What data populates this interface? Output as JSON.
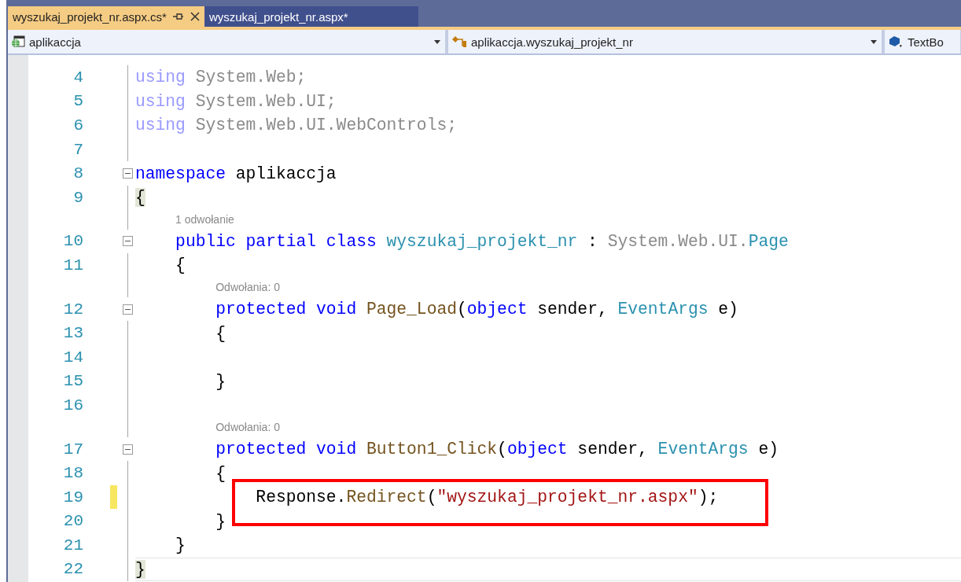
{
  "tabs": [
    {
      "label": "wyszukaj_projekt_nr.aspx.cs*",
      "selected": true
    },
    {
      "label": "wyszukaj_projekt_nr.aspx*",
      "selected": false
    }
  ],
  "nav_bar": [
    {
      "kind": "project",
      "label": "aplikaccja"
    },
    {
      "kind": "class",
      "label": "aplikaccja.wyszukaj_projekt_nr"
    },
    {
      "kind": "member",
      "label": "TextBo"
    }
  ],
  "lines": [
    {
      "kind": "code",
      "number": "4",
      "fold": false,
      "modified": false,
      "boxed": false,
      "current": false,
      "tokens": [
        {
          "text": "using",
          "kind": "faded-keyword"
        },
        {
          "text": " System.Web;",
          "kind": "faded"
        }
      ]
    },
    {
      "kind": "code",
      "number": "5",
      "fold": false,
      "modified": false,
      "boxed": false,
      "current": false,
      "tokens": [
        {
          "text": "using",
          "kind": "faded-keyword"
        },
        {
          "text": " System.Web.UI;",
          "kind": "faded"
        }
      ]
    },
    {
      "kind": "code",
      "number": "6",
      "fold": false,
      "modified": false,
      "boxed": false,
      "current": false,
      "tokens": [
        {
          "text": "using",
          "kind": "faded-keyword"
        },
        {
          "text": " System.Web.UI.WebControls;",
          "kind": "faded"
        }
      ]
    },
    {
      "kind": "code",
      "number": "7",
      "fold": false,
      "modified": false,
      "boxed": false,
      "current": false
    },
    {
      "kind": "code",
      "number": "8",
      "fold": true,
      "modified": false,
      "boxed": false,
      "current": false,
      "tokens": [
        {
          "text": "namespace",
          "kind": "keyword"
        },
        {
          "text": " aplikaccja",
          "kind": "plain"
        }
      ]
    },
    {
      "kind": "code",
      "number": "9",
      "fold": false,
      "modified": false,
      "boxed": false,
      "current": false,
      "tokens": [
        {
          "text": "{",
          "kind": "brace-match"
        }
      ]
    },
    {
      "kind": "codelens",
      "text": "1 odwołanie"
    },
    {
      "kind": "code",
      "number": "10",
      "fold": true,
      "modified": false,
      "boxed": false,
      "current": false,
      "tokens": [
        {
          "text": "    public partial class ",
          "kind": "keyword"
        },
        {
          "text": "wyszukaj_projekt_nr",
          "kind": "type"
        },
        {
          "text": " : ",
          "kind": "plain"
        },
        {
          "text": "System.Web.UI.",
          "kind": "faded"
        },
        {
          "text": "Page",
          "kind": "type"
        }
      ]
    },
    {
      "kind": "code",
      "number": "11",
      "fold": false,
      "modified": false,
      "boxed": false,
      "current": false,
      "tokens": [
        {
          "text": "    {",
          "kind": "plain"
        }
      ]
    },
    {
      "kind": "codelens",
      "text": "Odwołania: 0"
    },
    {
      "kind": "code",
      "number": "12",
      "fold": true,
      "modified": false,
      "boxed": false,
      "current": false,
      "tokens": [
        {
          "text": "        protected void ",
          "kind": "keyword"
        },
        {
          "text": "Page_Load",
          "kind": "method"
        },
        {
          "text": "(",
          "kind": "plain"
        },
        {
          "text": "object",
          "kind": "keyword"
        },
        {
          "text": " sender, ",
          "kind": "plain"
        },
        {
          "text": "EventArgs",
          "kind": "type"
        },
        {
          "text": " e)",
          "kind": "plain"
        }
      ]
    },
    {
      "kind": "code",
      "number": "13",
      "fold": false,
      "modified": false,
      "boxed": false,
      "current": false,
      "tokens": [
        {
          "text": "        {",
          "kind": "plain"
        }
      ]
    },
    {
      "kind": "code",
      "number": "14",
      "fold": false,
      "modified": false,
      "boxed": false,
      "current": false
    },
    {
      "kind": "code",
      "number": "15",
      "fold": false,
      "modified": false,
      "boxed": false,
      "current": false,
      "tokens": [
        {
          "text": "        }",
          "kind": "plain"
        }
      ]
    },
    {
      "kind": "code",
      "number": "16",
      "fold": false,
      "modified": false,
      "boxed": false,
      "current": false
    },
    {
      "kind": "codelens",
      "text": "Odwołania: 0"
    },
    {
      "kind": "code",
      "number": "17",
      "fold": true,
      "modified": false,
      "boxed": false,
      "current": false,
      "tokens": [
        {
          "text": "        protected void ",
          "kind": "keyword"
        },
        {
          "text": "Button1_Click",
          "kind": "method"
        },
        {
          "text": "(",
          "kind": "plain"
        },
        {
          "text": "object",
          "kind": "keyword"
        },
        {
          "text": " sender, ",
          "kind": "plain"
        },
        {
          "text": "EventArgs",
          "kind": "type"
        },
        {
          "text": " e)",
          "kind": "plain"
        }
      ]
    },
    {
      "kind": "code",
      "number": "18",
      "fold": false,
      "modified": false,
      "boxed": false,
      "current": false,
      "tokens": [
        {
          "text": "        {",
          "kind": "plain"
        }
      ]
    },
    {
      "kind": "code",
      "number": "19",
      "fold": false,
      "modified": true,
      "boxed": true,
      "current": false,
      "tokens": [
        {
          "text": "            Response.",
          "kind": "plain"
        },
        {
          "text": "Redirect",
          "kind": "method"
        },
        {
          "text": "(",
          "kind": "plain"
        },
        {
          "text": "\"wyszukaj_projekt_nr.aspx\"",
          "kind": "string"
        },
        {
          "text": ");",
          "kind": "plain"
        }
      ]
    },
    {
      "kind": "code",
      "number": "20",
      "fold": false,
      "modified": false,
      "boxed": false,
      "current": false,
      "tokens": [
        {
          "text": "        }",
          "kind": "plain"
        }
      ]
    },
    {
      "kind": "code",
      "number": "21",
      "fold": false,
      "modified": false,
      "boxed": false,
      "current": false,
      "tokens": [
        {
          "text": "    }",
          "kind": "plain"
        }
      ]
    },
    {
      "kind": "code",
      "number": "22",
      "fold": false,
      "modified": false,
      "boxed": false,
      "current": true,
      "tokens": [
        {
          "text": "}",
          "kind": "brace-match"
        }
      ]
    }
  ]
}
